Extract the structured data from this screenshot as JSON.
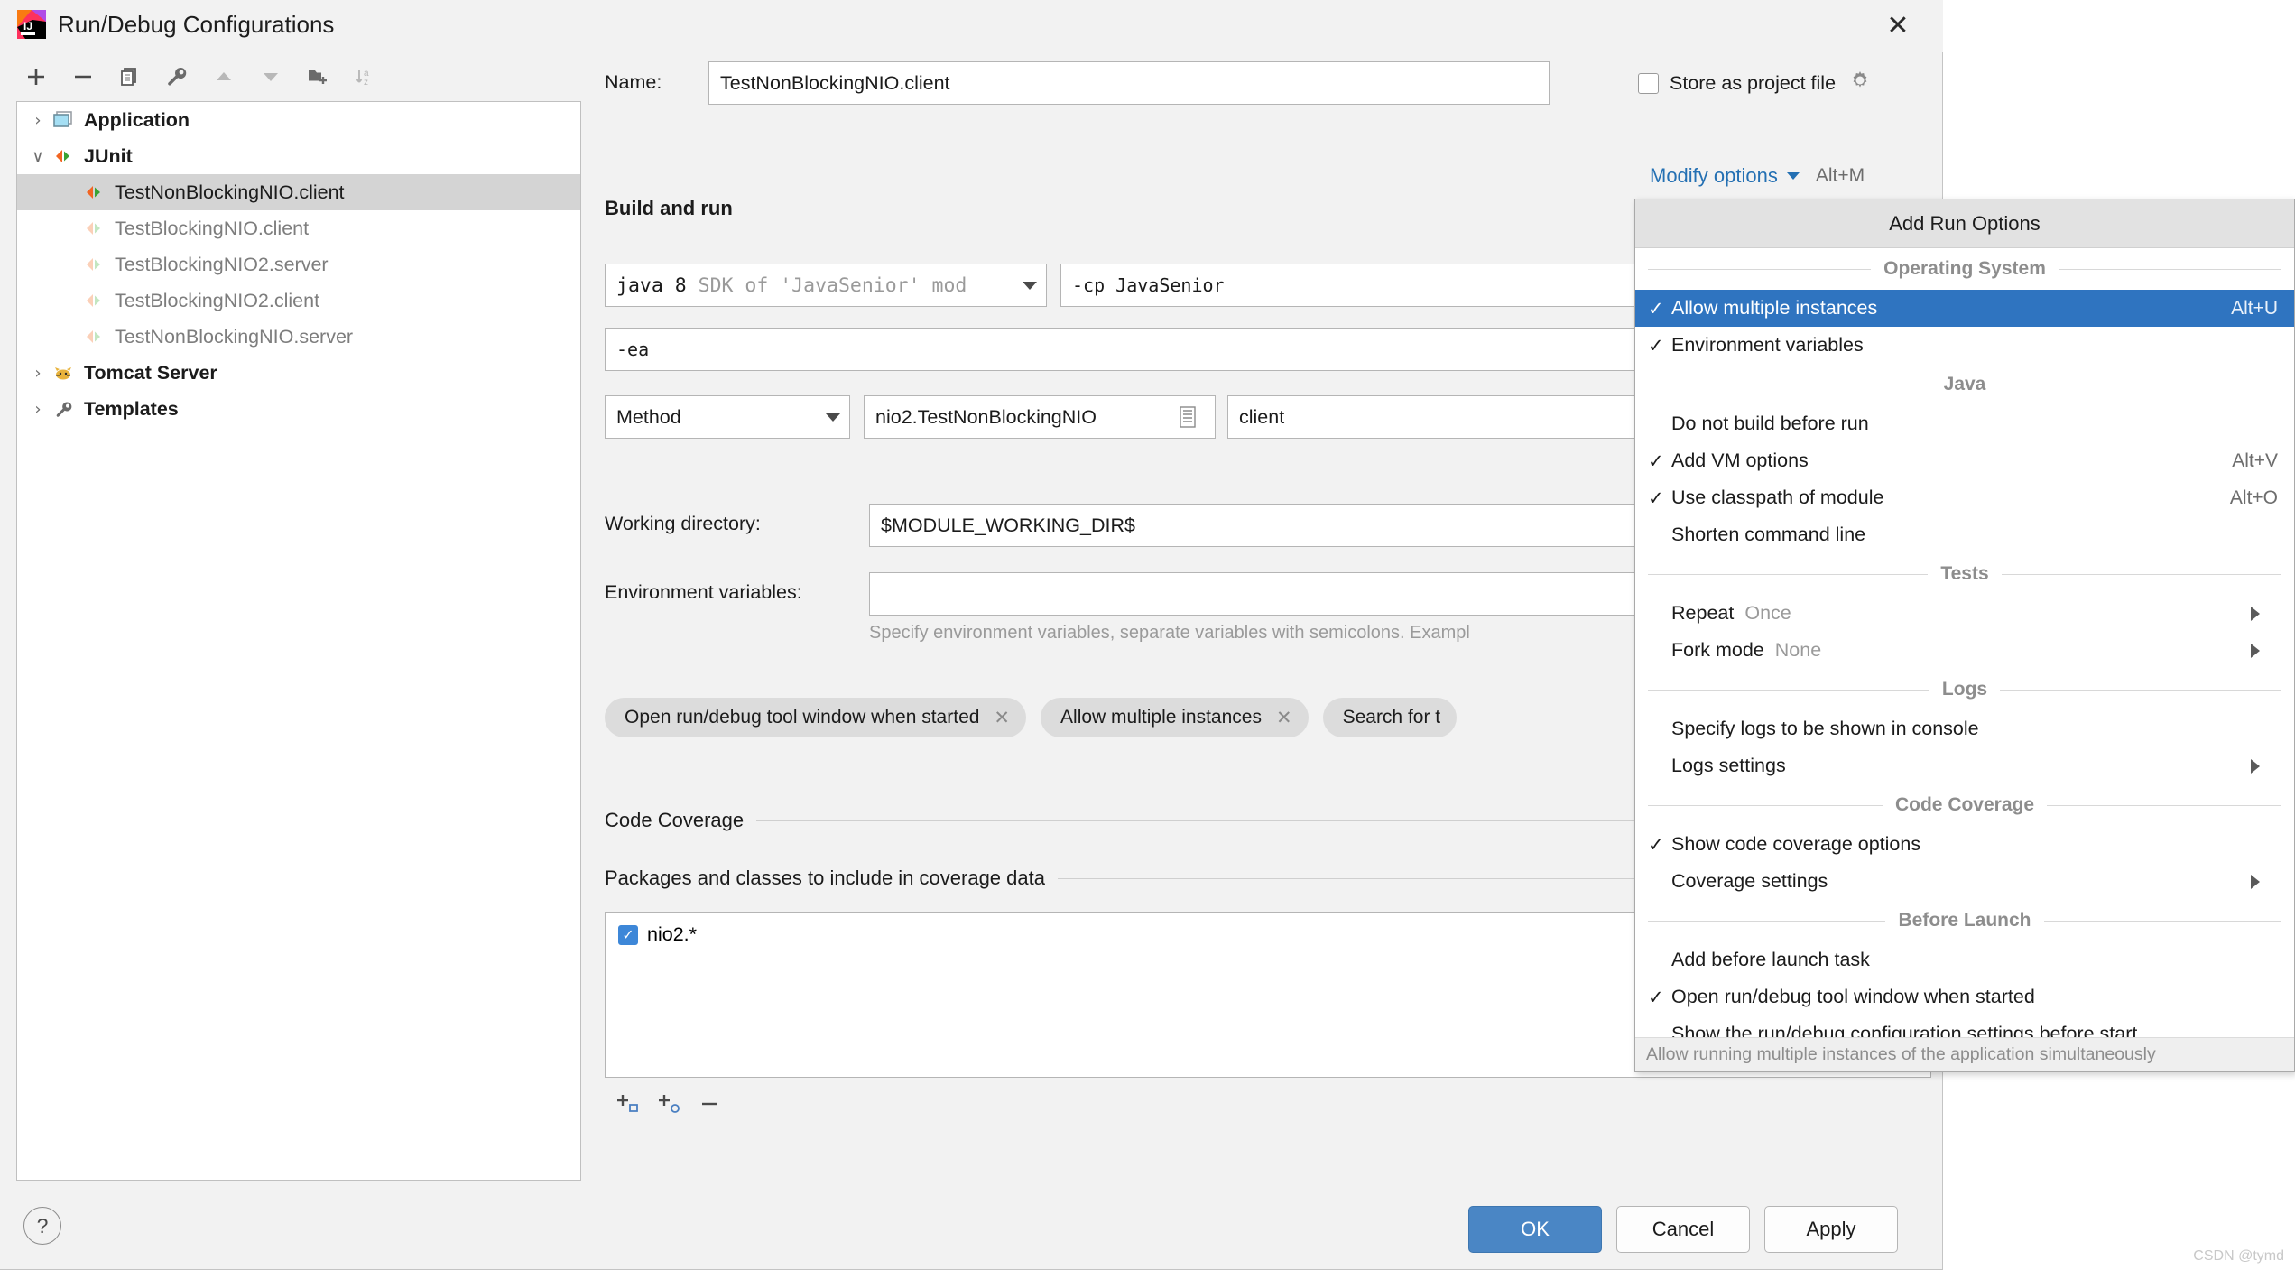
{
  "window": {
    "title": "Run/Debug Configurations",
    "close_label": "✕",
    "app_icon": "intellij-idea-icon"
  },
  "toolbar": {
    "buttons": [
      {
        "name": "add-configuration-button",
        "icon": "plus-icon"
      },
      {
        "name": "remove-configuration-button",
        "icon": "minus-icon"
      },
      {
        "name": "copy-configuration-button",
        "icon": "copy-icon"
      },
      {
        "name": "edit-templates-button",
        "icon": "wrench-icon"
      },
      {
        "name": "move-up-button",
        "icon": "triangle-up-icon"
      },
      {
        "name": "move-down-button",
        "icon": "triangle-down-icon"
      },
      {
        "name": "move-into-folder-button",
        "icon": "new-folder-icon"
      },
      {
        "name": "sort-configurations-button",
        "icon": "sort-az-icon"
      }
    ]
  },
  "tree": {
    "items": [
      {
        "label": "Application",
        "level": 0,
        "arrow": "›",
        "icon": "application-icon",
        "style": "bold",
        "selected": false
      },
      {
        "label": "JUnit",
        "level": 0,
        "arrow": "∨",
        "icon": "junit-icon",
        "style": "bold",
        "selected": false
      },
      {
        "label": "TestNonBlockingNIO.client",
        "level": 1,
        "arrow": "",
        "icon": "junit-icon",
        "style": "normal",
        "selected": true
      },
      {
        "label": "TestBlockingNIO.client",
        "level": 1,
        "arrow": "",
        "icon": "junit-icon-faded",
        "style": "dim",
        "selected": false
      },
      {
        "label": "TestBlockingNIO2.server",
        "level": 1,
        "arrow": "",
        "icon": "junit-icon-faded",
        "style": "dim",
        "selected": false
      },
      {
        "label": "TestBlockingNIO2.client",
        "level": 1,
        "arrow": "",
        "icon": "junit-icon-faded",
        "style": "dim",
        "selected": false
      },
      {
        "label": "TestNonBlockingNIO.server",
        "level": 1,
        "arrow": "",
        "icon": "junit-icon-faded",
        "style": "dim",
        "selected": false
      },
      {
        "label": "Tomcat Server",
        "level": 0,
        "arrow": "›",
        "icon": "tomcat-icon",
        "style": "bold",
        "selected": false
      },
      {
        "label": "Templates",
        "level": 0,
        "arrow": "›",
        "icon": "wrench-icon",
        "style": "bold",
        "selected": false
      }
    ]
  },
  "form": {
    "name_label": "Name:",
    "name_value": "TestNonBlockingNIO.client",
    "store_as_project_file_label": "Store as project file",
    "store_as_project_file_checked": false,
    "build_and_run_title": "Build and run",
    "modify_options_label": "Modify options",
    "modify_options_shortcut": "Alt+M",
    "jre_value_main": "java 8",
    "jre_value_dim": "SDK of 'JavaSenior' mod",
    "cp_value": "-cp JavaSenior",
    "vm_options_value": "-ea",
    "kind_value": "Method",
    "class_value": "nio2.TestNonBlockingNIO",
    "method_value": "client",
    "working_directory_label": "Working directory:",
    "working_directory_value": "$MODULE_WORKING_DIR$",
    "environment_variables_label": "Environment variables:",
    "environment_variables_value": "",
    "environment_variables_hint": "Specify environment variables, separate variables with semicolons. Exampl",
    "chips": [
      {
        "label": "Open run/debug tool window when started",
        "close": "✕"
      },
      {
        "label": "Allow multiple instances",
        "close": "✕"
      },
      {
        "label": "Search for t",
        "close": ""
      }
    ],
    "code_coverage_title": "Code Coverage",
    "packages_title": "Packages and classes to include in coverage data",
    "coverage_items": [
      {
        "label": "nio2.*",
        "checked": true
      }
    ],
    "coverage_toolbar": [
      {
        "name": "add-package-button",
        "icon": "plus-package-icon"
      },
      {
        "name": "add-class-button",
        "icon": "plus-class-icon"
      },
      {
        "name": "remove-coverage-entry-button",
        "icon": "minus-icon"
      }
    ]
  },
  "footer": {
    "help_label": "?",
    "ok_label": "OK",
    "cancel_label": "Cancel",
    "apply_label": "Apply"
  },
  "popup": {
    "header": "Add Run Options",
    "groups": [
      {
        "title": "Operating System",
        "items": [
          {
            "label": "Allow multiple instances",
            "checked": true,
            "shortcut": "Alt+U",
            "selected": true,
            "submenu": false,
            "value": ""
          },
          {
            "label": "Environment variables",
            "checked": true,
            "shortcut": "",
            "selected": false,
            "submenu": false,
            "value": ""
          }
        ]
      },
      {
        "title": "Java",
        "items": [
          {
            "label": "Do not build before run",
            "checked": false,
            "shortcut": "",
            "selected": false,
            "submenu": false,
            "value": ""
          },
          {
            "label": "Add VM options",
            "checked": true,
            "shortcut": "Alt+V",
            "selected": false,
            "submenu": false,
            "value": ""
          },
          {
            "label": "Use classpath of module",
            "checked": true,
            "shortcut": "Alt+O",
            "selected": false,
            "submenu": false,
            "value": ""
          },
          {
            "label": "Shorten command line",
            "checked": false,
            "shortcut": "",
            "selected": false,
            "submenu": false,
            "value": ""
          }
        ]
      },
      {
        "title": "Tests",
        "items": [
          {
            "label": "Repeat",
            "checked": false,
            "shortcut": "",
            "selected": false,
            "submenu": true,
            "value": "Once"
          },
          {
            "label": "Fork mode",
            "checked": false,
            "shortcut": "",
            "selected": false,
            "submenu": true,
            "value": "None"
          }
        ]
      },
      {
        "title": "Logs",
        "items": [
          {
            "label": "Specify logs to be shown in console",
            "checked": false,
            "shortcut": "",
            "selected": false,
            "submenu": false,
            "value": ""
          },
          {
            "label": "Logs settings",
            "checked": false,
            "shortcut": "",
            "selected": false,
            "submenu": true,
            "value": ""
          }
        ]
      },
      {
        "title": "Code Coverage",
        "items": [
          {
            "label": "Show code coverage options",
            "checked": true,
            "shortcut": "",
            "selected": false,
            "submenu": false,
            "value": ""
          },
          {
            "label": "Coverage settings",
            "checked": false,
            "shortcut": "",
            "selected": false,
            "submenu": true,
            "value": ""
          }
        ]
      },
      {
        "title": "Before Launch",
        "items": [
          {
            "label": "Add before launch task",
            "checked": false,
            "shortcut": "",
            "selected": false,
            "submenu": false,
            "value": ""
          },
          {
            "label": "Open run/debug tool window when started",
            "checked": true,
            "shortcut": "",
            "selected": false,
            "submenu": false,
            "value": ""
          },
          {
            "label": "Show the run/debug configuration settings before start",
            "checked": false,
            "shortcut": "",
            "selected": false,
            "submenu": false,
            "value": ""
          }
        ]
      }
    ],
    "footer_hint": "Allow running multiple instances of the application simultaneously"
  },
  "watermark": "CSDN @tymd",
  "colors": {
    "accent": "#2f74c0",
    "link": "#2470b3",
    "selection": "#d4d4d4",
    "checkbox_blue": "#3d87d8"
  }
}
